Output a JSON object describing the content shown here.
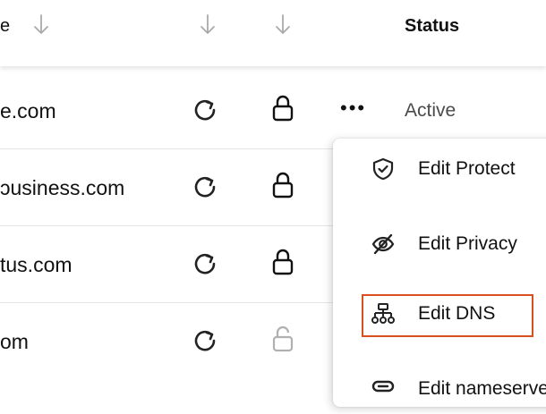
{
  "header": {
    "col_domain_partial": "e",
    "status_label": "Status"
  },
  "rows": [
    {
      "domain": "e.com",
      "status": "Active",
      "more": "•••"
    },
    {
      "domain": "ɔusiness.com"
    },
    {
      "domain": "tus.com"
    },
    {
      "domain": "om"
    }
  ],
  "menu": {
    "items": [
      {
        "label": "Edit Protect",
        "icon": "shield-check-icon"
      },
      {
        "label": "Edit Privacy",
        "icon": "eye-slash-icon"
      },
      {
        "label": "Edit DNS",
        "icon": "network-icon"
      },
      {
        "label": "Edit nameservers",
        "icon": "server-icon"
      }
    ]
  },
  "colors": {
    "highlight": "#d9501f",
    "muted_icon": "#b0b0b0",
    "status_text": "#4a4a4a"
  }
}
